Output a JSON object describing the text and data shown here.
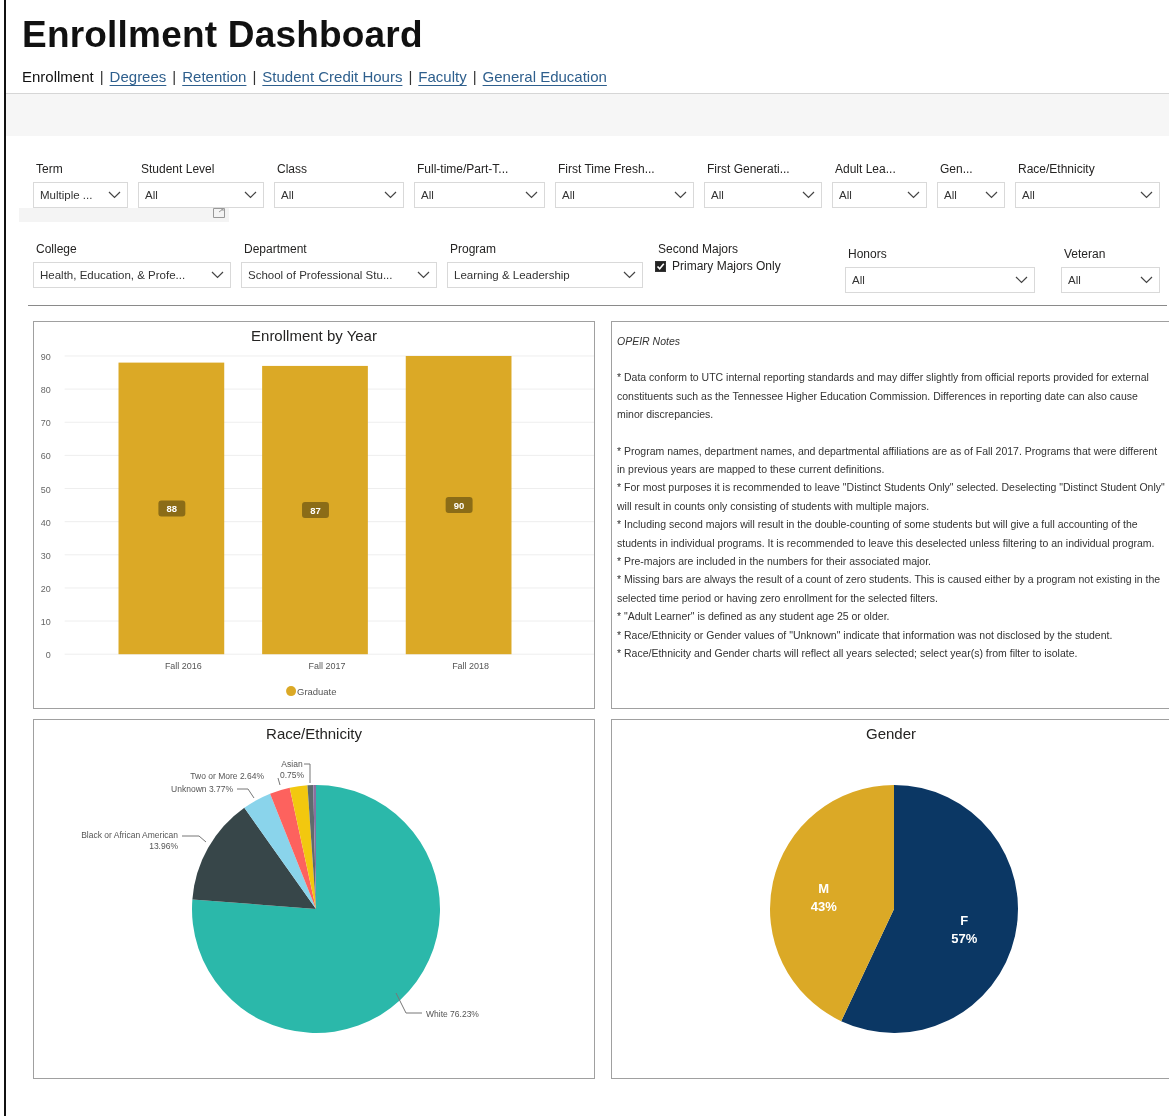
{
  "title": "Enrollment Dashboard",
  "nav": [
    {
      "label": "Enrollment",
      "selected": true
    },
    {
      "label": "Degrees",
      "selected": false,
      "separator": "|"
    },
    {
      "label": "Retention",
      "selected": false,
      "separator": "|"
    },
    {
      "label": "Student Credit Hours",
      "selected": false,
      "separator": "|"
    },
    {
      "label": "Faculty",
      "selected": false,
      "separator": "|"
    },
    {
      "label": "General Education",
      "selected": false,
      "separator": "|"
    }
  ],
  "filters_row_1": [
    {
      "label": "Term",
      "value": "Multiple ..."
    },
    {
      "label": "Student Level",
      "value": "All"
    },
    {
      "label": "Class",
      "value": "All"
    },
    {
      "label": "Full-time/Part-T...",
      "value": "All"
    },
    {
      "label": "First Time Fresh...",
      "value": "All"
    },
    {
      "label": "First Generati...",
      "value": "All"
    },
    {
      "label": "Adult Lea...",
      "value": "All"
    },
    {
      "label": "Gen...",
      "value": "All"
    },
    {
      "label": "Race/Ethnicity",
      "value": "All"
    }
  ],
  "filters_row_2": [
    {
      "kind": "dropdown",
      "label": "College",
      "value": "Health, Education, & Profe..."
    },
    {
      "kind": "dropdown",
      "label": "Department",
      "value": "School of Professional Stu..."
    },
    {
      "kind": "dropdown",
      "label": "Program",
      "value": "Learning & Leadership"
    },
    {
      "kind": "checkbox",
      "label": "Second Majors",
      "option": "Primary Majors Only",
      "checked": true
    },
    {
      "kind": "dropdown",
      "label": "Honors",
      "value": "All"
    },
    {
      "kind": "dropdown",
      "label": "Veteran",
      "value": "All"
    }
  ],
  "enrollment_chart": {
    "chart_data": {
      "type": "bar",
      "title": "Enrollment by Year",
      "categories": [
        "Fall 2016",
        "Fall 2017",
        "Fall 2018"
      ],
      "series": [
        {
          "name": "Graduate",
          "color": "#dba926",
          "values": [
            88,
            87,
            90
          ]
        }
      ],
      "ylim": [
        0,
        90
      ],
      "yticks": [
        0,
        10,
        20,
        30,
        40,
        50,
        60,
        70,
        80,
        90
      ],
      "grid": true,
      "data_labels": true
    }
  },
  "notes": {
    "title": "OPEIR Notes",
    "paragraphs": [
      "* Data conform to UTC internal reporting standards and may differ slightly from official reports provided for external constituents such as the Tennessee Higher Education Commission. Differences in reporting date can also cause minor discrepancies.",
      "* Program names, department names, and departmental affiliations are as of Fall 2017. Programs that were different in previous years are mapped to these current definitions.",
      "* For most purposes it is recommended to leave \"Distinct Students Only\" selected. Deselecting \"Distinct Student Only\" will result in counts only consisting of students with multiple majors.",
      "* Including second majors will result in the double-counting of some students but will give a full accounting of the students in individual programs. It is recommended to leave this deselected unless filtering to an individual program.",
      "* Pre-majors are included in the numbers for their associated major.",
      "* Missing bars are always the result of a count of zero students. This is caused either by a program not existing in the selected time period or having zero enrollment for the selected filters.",
      "* \"Adult Learner\" is defined as any student age 25 or older.",
      "* Race/Ethnicity or Gender values of \"Unknown\" indicate that information was not disclosed by the student.",
      "* Race/Ethnicity and Gender charts will reflect all years selected; select year(s) from filter to isolate."
    ]
  },
  "race_chart": {
    "chart_data": {
      "type": "pie",
      "title": "Race/Ethnicity",
      "categories": [
        "White",
        "Black or African American",
        "Unknown",
        "Two or More",
        null,
        "Asian",
        null
      ],
      "series": [
        {
          "values": [
            76.23,
            13.96,
            3.77,
            2.64,
            2.3,
            0.75,
            0.35
          ]
        }
      ],
      "colors": [
        "#2bb8aa",
        "#374649",
        "#8ad4eb",
        "#fd625e",
        "#f2c80f",
        "#5f6b6d",
        "#8a6fa0"
      ],
      "value_labels": [
        "76.23%",
        "13.96%",
        "3.77%",
        "2.64%",
        null,
        "0.75%",
        null
      ]
    }
  },
  "gender_chart": {
    "chart_data": {
      "type": "pie",
      "title": "Gender",
      "categories": [
        "F",
        "M"
      ],
      "series": [
        {
          "values": [
            57,
            43
          ]
        }
      ],
      "colors": [
        "#0b3764",
        "#dba926"
      ],
      "value_labels": [
        "57%",
        "43%"
      ]
    }
  }
}
